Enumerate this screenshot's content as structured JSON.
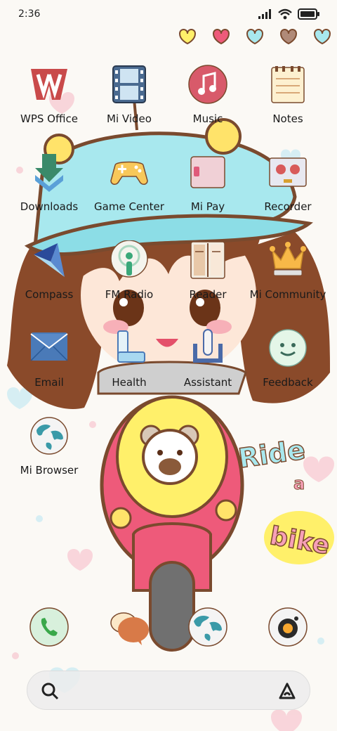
{
  "status_bar": {
    "time": "2:36"
  },
  "apps": [
    {
      "label": "WPS Office",
      "icon": "wps-office-icon"
    },
    {
      "label": "Mi Video",
      "icon": "film-strip-icon"
    },
    {
      "label": "Music",
      "icon": "music-note-icon"
    },
    {
      "label": "Notes",
      "icon": "notepad-icon"
    },
    {
      "label": "Downloads",
      "icon": "download-arrow-icon"
    },
    {
      "label": "Game Center",
      "icon": "gamepad-icon"
    },
    {
      "label": "Mi Pay",
      "icon": "wallet-card-icon"
    },
    {
      "label": "Recorder",
      "icon": "recorder-icon"
    },
    {
      "label": "Compass",
      "icon": "compass-icon"
    },
    {
      "label": "FM Radio",
      "icon": "radio-icon"
    },
    {
      "label": "Reader",
      "icon": "book-icon"
    },
    {
      "label": "Mi Community",
      "icon": "crown-icon"
    },
    {
      "label": "Email",
      "icon": "envelope-icon"
    },
    {
      "label": "Health",
      "icon": "health-icon"
    },
    {
      "label": "Assistant",
      "icon": "assistant-icon"
    },
    {
      "label": "Feedback",
      "icon": "smiley-face-icon"
    },
    {
      "label": "Mi Browser",
      "icon": "globe-icon"
    }
  ],
  "dock": [
    {
      "icon": "phone-icon"
    },
    {
      "icon": "messages-icon"
    },
    {
      "icon": "globe-icon"
    },
    {
      "icon": "camera-icon"
    }
  ],
  "wallpaper_text": {
    "line1": "Ride",
    "line2": "a",
    "line3": "bike"
  },
  "colors": {
    "background": "#fbf9f5",
    "helmet": "#a8e8ee",
    "scooter": "#ee5a7a",
    "hair": "#8a4a2a"
  }
}
